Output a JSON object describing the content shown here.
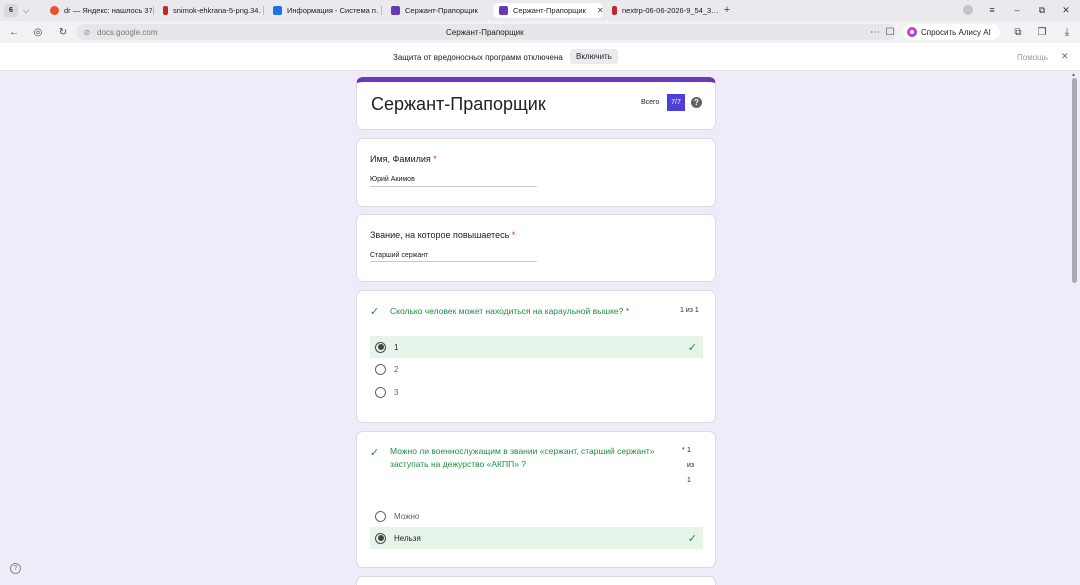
{
  "browser": {
    "tab_count": "6",
    "tabs": [
      {
        "title": "dr — Яндекс: нашлось 37…",
        "color": "#e8502f"
      },
      {
        "title": "snimok-ehkrana-5-png.34…",
        "color": "#c4252b"
      },
      {
        "title": "Информация - Система п…",
        "color": "#1a73e8"
      },
      {
        "title": "Сержант-Прапорщик",
        "color": "#673ab7"
      },
      {
        "title": "Сержант-Прапорщик",
        "color": "#673ab7"
      },
      {
        "title": "nextrp-06-06-2026-9_54_3…",
        "color": "#c4252b"
      }
    ],
    "url": "docs.google.com",
    "page_title": "Сержант-Прапорщик",
    "alice_label": "Спросить Алису AI"
  },
  "infobar": {
    "text": "Защита от вредоносных программ отключена",
    "button": "Включить",
    "help": "Помощь"
  },
  "form": {
    "title": "Сержант-Прапорщик",
    "score_label": "Всего",
    "score": "7/7",
    "help_icon": "?",
    "fields": [
      {
        "label": "Имя, Фамилия",
        "required": "*",
        "value": "Юрий Акимов"
      },
      {
        "label": "Звание, на которое повышаетесь",
        "required": "*",
        "value": "Старший сержант"
      }
    ],
    "questions": [
      {
        "text": "Сколько человек может находиться на караульной вышке?",
        "required": "*",
        "points": "1 из 1",
        "options": [
          "1",
          "2",
          "3"
        ],
        "selected_index": 0
      },
      {
        "text_line1": "Можно ли военнослужащим в звании «сержант, старший сержант»",
        "text_line2": "заступать на дежурство «АКПП» ?",
        "required": "*",
        "points_parts": [
          "1",
          "из",
          "1"
        ],
        "options": [
          "Можно",
          "Нельзя"
        ],
        "selected_index": 1
      }
    ]
  },
  "icons": {
    "check": "✓",
    "accent_color": "#673ab7",
    "correct_color": "#1e8e3e"
  }
}
